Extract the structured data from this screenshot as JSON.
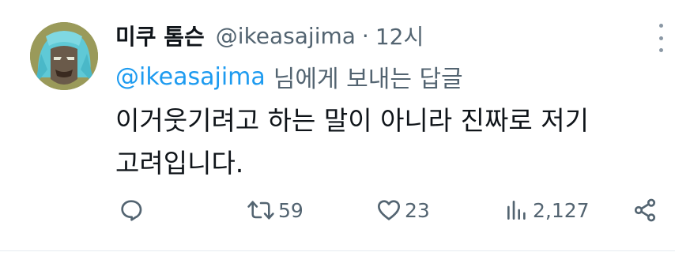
{
  "tweet": {
    "author": {
      "display_name": "미쿠 톰슨",
      "handle": "@ikeasajima",
      "avatar_icon": "avatar-icon"
    },
    "separator": "·",
    "time": "12시",
    "reply_to": {
      "handle": "@ikeasajima",
      "suffix": "님에게 보내는 답글"
    },
    "text_lines": [
      "이거웃기려고 하는 말이 아니라 진짜로 저기",
      "고려입니다."
    ],
    "actions": {
      "reply": {
        "icon": "comment-icon",
        "count": ""
      },
      "retweet": {
        "icon": "retweet-icon",
        "count": "59"
      },
      "like": {
        "icon": "heart-icon",
        "count": "23"
      },
      "views": {
        "icon": "analytics-icon",
        "count": "2,127"
      },
      "share": {
        "icon": "share-icon",
        "count": ""
      }
    }
  },
  "colors": {
    "text": "#0f1419",
    "muted": "#536471",
    "link": "#1d9bf0",
    "divider": "#e6ecf0"
  }
}
